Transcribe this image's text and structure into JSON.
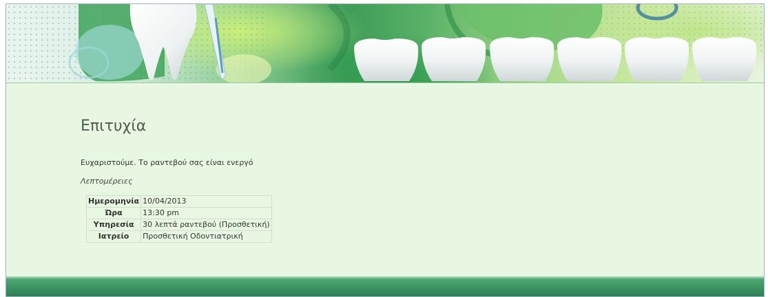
{
  "page": {
    "title": "Επιτυχία",
    "message": "Ευχαριστούμε. Το ραντεβού σας είναι ενεργό",
    "details_label": "Λεπτομέρειες"
  },
  "details": [
    {
      "label": "Ημερομηνία",
      "value": "10/04/2013"
    },
    {
      "label": "Ώρα",
      "value": "13:30 pm"
    },
    {
      "label": "Υπηρεσία",
      "value": "30 λεπτά ραντεβού (Προσθετική)"
    },
    {
      "label": "Ιατρείο",
      "value": "Προσθετική Οδοντιατρική"
    }
  ],
  "colors": {
    "page_background": "#e8f7e2",
    "banner_green": "#3f9d58",
    "footer_green": "#3c9563",
    "title_text": "#555a55"
  },
  "banner": {
    "icons": [
      "tooth-icon",
      "toothbrush-icon",
      "teeth-row-icon"
    ]
  }
}
